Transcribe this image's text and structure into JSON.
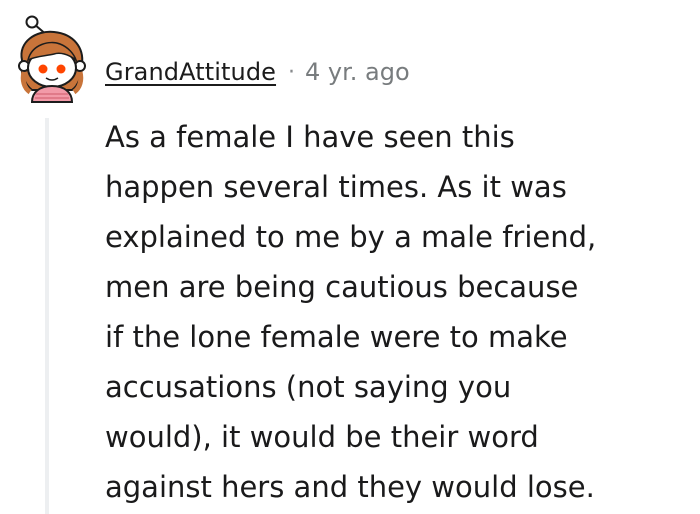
{
  "comment": {
    "author": "GrandAttitude",
    "separator": "·",
    "timestamp": "4 yr. ago",
    "avatar_icon": "snoo-avatar-icon",
    "body_lines": [
      "As a female I have seen this",
      "happen several times. As it was",
      "explained to me by a male friend,",
      "men are being cautious because",
      "if the lone female were to make",
      "accusations (not saying you",
      "would), it would be their word",
      "against hers and they would lose."
    ]
  },
  "colors": {
    "text": "#1a1a1b",
    "meta": "#787c7e",
    "thread_line": "#edeff1",
    "avatar_hair": "#c8743a",
    "avatar_eyes": "#ff4500",
    "avatar_shirt": "#f29aa8"
  }
}
